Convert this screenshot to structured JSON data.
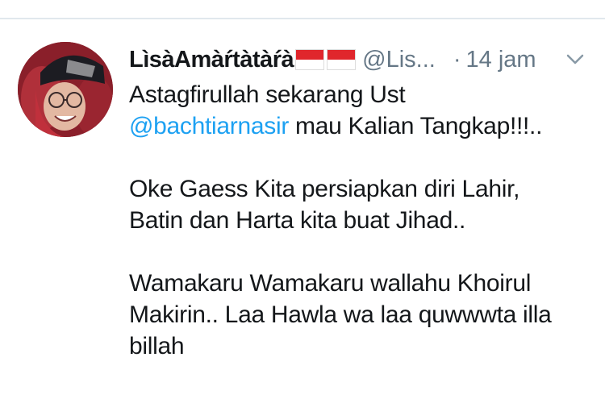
{
  "tweet": {
    "author": {
      "display_name": "LìsàAmàŕtàtàŕà",
      "flags": [
        "indonesia-flag",
        "indonesia-flag"
      ],
      "handle": "@Lis...",
      "avatar": "user-avatar-photo"
    },
    "separator": "·",
    "time": "14 jam",
    "menu_icon": "chevron-down-icon",
    "body": {
      "line1": "Astagfirullah sekarang Ust",
      "mention": "@bachtiarnasir",
      "line2_rest": " mau Kalian Tangkap!!!..",
      "para2_line1": "Oke Gaess Kita persiapkan diri Lahir,",
      "para2_line2": "Batin dan Harta kita buat Jihad..",
      "para3_line1": "Wamakaru Wamakaru wallahu Khoirul",
      "para3_line2": "Makirin.. Laa Hawla wa laa quwwwta illa",
      "para3_line3": "billah"
    }
  },
  "colors": {
    "text": "#14171a",
    "secondary": "#657786",
    "link": "#1da1f2",
    "divider": "#e1e8ed",
    "flag_red": "#e0262c"
  }
}
